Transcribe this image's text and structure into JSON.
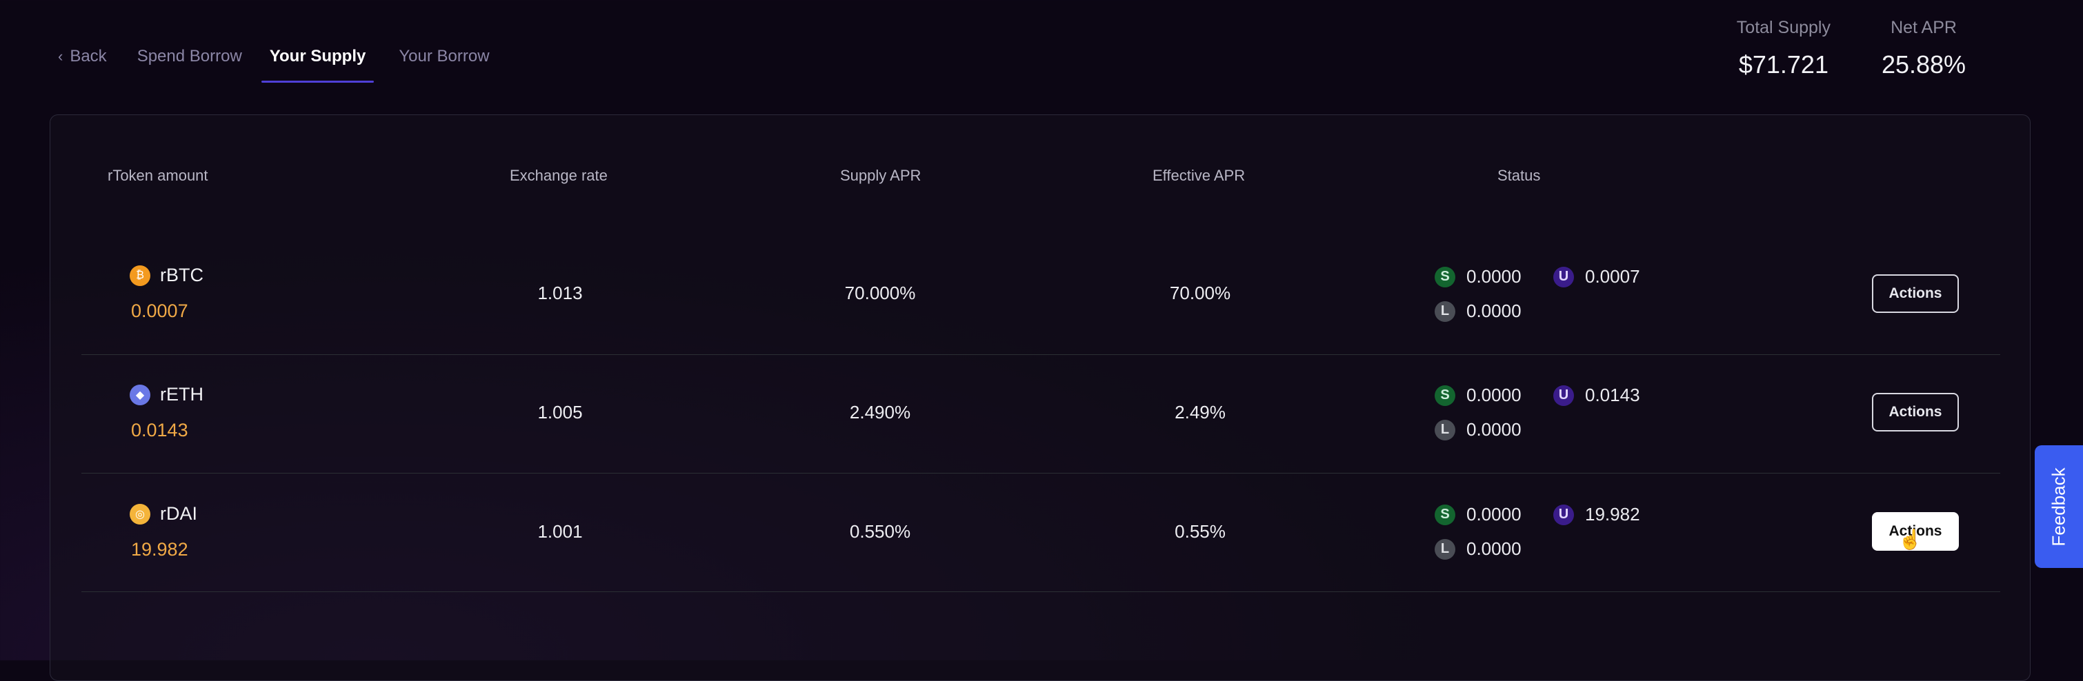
{
  "nav": {
    "back_label": "Back",
    "spend_borrow_label": "Spend Borrow",
    "your_supply_label": "Your Supply",
    "your_borrow_label": "Your Borrow"
  },
  "stats": {
    "total_supply_label": "Total Supply",
    "total_supply_value": "$71.721",
    "net_apr_label": "Net APR",
    "net_apr_value": "25.88%"
  },
  "table": {
    "headers": [
      "rToken amount",
      "Exchange rate",
      "Supply APR",
      "Effective APR",
      "Status"
    ],
    "rows": [
      {
        "token": "rBTC",
        "icon": "bitcoin-icon",
        "amount": "0.0007",
        "exchange_rate": "1.013",
        "supply_apr": "70.000%",
        "effective_apr": "70.00%",
        "status": {
          "s_label": "S",
          "s": "0.0000",
          "u_label": "U",
          "u": "0.0007",
          "l_label": "L",
          "l": "0.0000"
        },
        "action_label": "Actions"
      },
      {
        "token": "rETH",
        "icon": "ethereum-icon",
        "amount": "0.0143",
        "exchange_rate": "1.005",
        "supply_apr": "2.490%",
        "effective_apr": "2.49%",
        "status": {
          "s_label": "S",
          "s": "0.0000",
          "u_label": "U",
          "u": "0.0143",
          "l_label": "L",
          "l": "0.0000"
        },
        "action_label": "Actions"
      },
      {
        "token": "rDAI",
        "icon": "dai-icon",
        "amount": "19.982",
        "exchange_rate": "1.001",
        "supply_apr": "0.550%",
        "effective_apr": "0.55%",
        "status": {
          "s_label": "S",
          "s": "0.0000",
          "u_label": "U",
          "u": "19.982",
          "l_label": "L",
          "l": "0.0000"
        },
        "action_label": "Actions"
      }
    ]
  },
  "feedback_label": "Feedback",
  "colors": {
    "accent": "#4f3fd6",
    "amount": "#f0a946",
    "feedback": "#3a5cf0"
  }
}
